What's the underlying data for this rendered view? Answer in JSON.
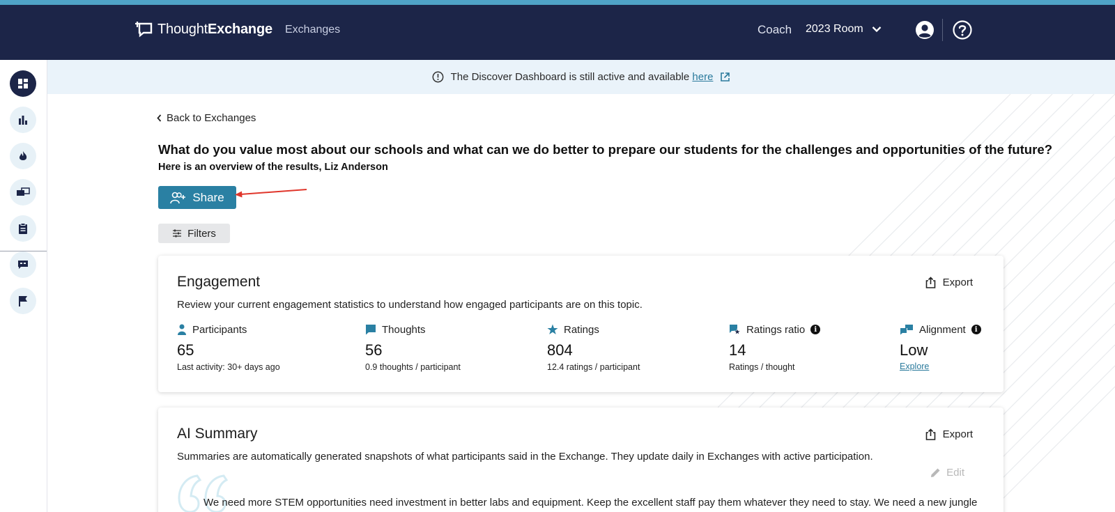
{
  "topbar": {
    "logo_light": "Thought",
    "logo_bold": "Exchange",
    "nav_exchanges": "Exchanges",
    "coach_label": "Coach",
    "room_label": "2023 Room"
  },
  "banner": {
    "text": "The Discover Dashboard is still active and available",
    "link": "here"
  },
  "page": {
    "back_link": "Back to Exchanges",
    "question": "What do you value most about our schools and what can we do better to prepare our students for the challenges and opportunities of the future?",
    "subtitle": "Here is an overview of the results, Liz Anderson",
    "share_label": "Share",
    "filters_label": "Filters"
  },
  "engagement": {
    "title": "Engagement",
    "export_label": "Export",
    "description": "Review your current engagement statistics to understand how engaged participants are on this topic.",
    "stats": [
      {
        "label": "Participants",
        "value": "65",
        "note": "Last activity: 30+ days ago"
      },
      {
        "label": "Thoughts",
        "value": "56",
        "note": "0.9 thoughts / participant"
      },
      {
        "label": "Ratings",
        "value": "804",
        "note": "12.4 ratings / participant"
      },
      {
        "label": "Ratings ratio",
        "value": "14",
        "note": "Ratings / thought"
      },
      {
        "label": "Alignment",
        "value": "Low",
        "link": "Explore"
      }
    ]
  },
  "ai_summary": {
    "title": "AI Summary",
    "export_label": "Export",
    "description": "Summaries are automatically generated snapshots of what participants said in the Exchange. They update daily in Exchanges with active participation.",
    "edit_label": "Edit",
    "text": "We need more STEM opportunities need investment in better labs and equipment. Keep the excellent staff pay them whatever they need to stay. We need a new jungle"
  },
  "colors": {
    "navbar": "#1c2548",
    "accent": "#2a80a3",
    "stripe": "#4fa3c7",
    "banner_bg": "#eaf3fa",
    "arrow": "#e0362b"
  }
}
